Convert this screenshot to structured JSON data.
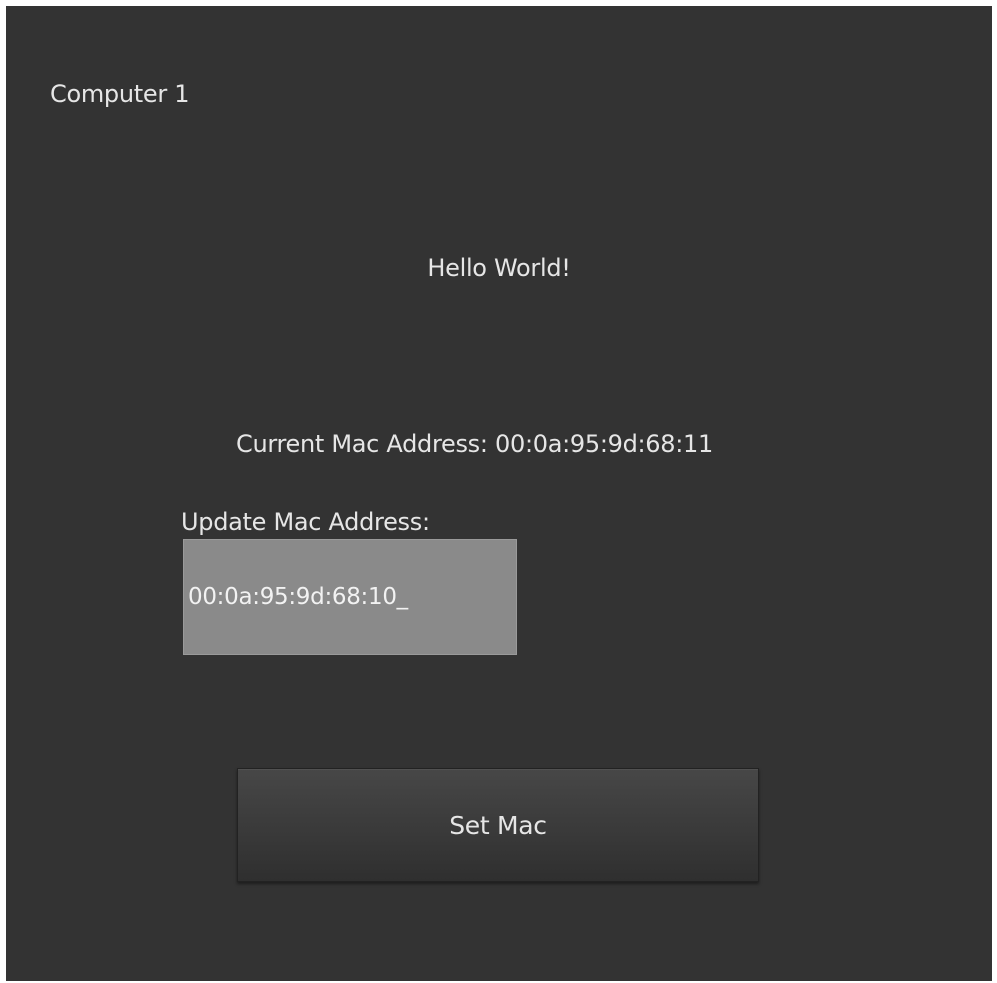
{
  "app": {
    "computer_name": "Computer 1",
    "greeting": "Hello World!"
  },
  "mac": {
    "current_label": "Current Mac Address: 00:0a:95:9d:68:11",
    "update_label": "Update Mac Address:",
    "input_value": "00:0a:95:9d:68:10_"
  },
  "actions": {
    "set_label": "Set Mac"
  },
  "colors": {
    "background": "#333333",
    "text": "#e6e6e6",
    "input_background": "#8a8a8a"
  }
}
